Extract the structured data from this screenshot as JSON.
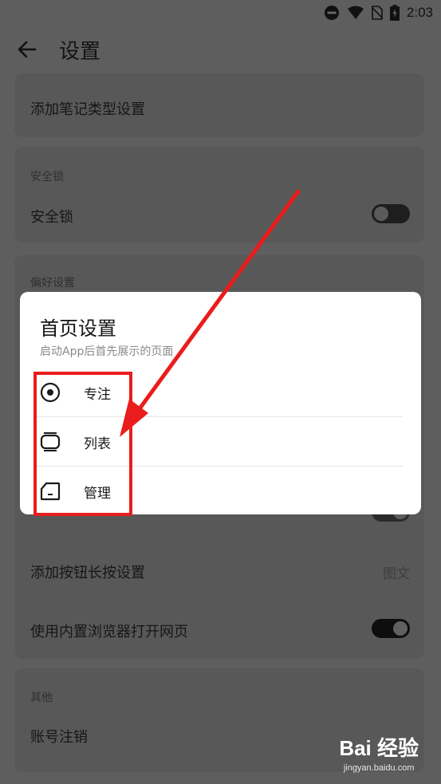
{
  "status_bar": {
    "time": "2:03"
  },
  "app_bar": {
    "title": "设置"
  },
  "settings": {
    "note_type": {
      "label": "添加笔记类型设置"
    },
    "security": {
      "header": "安全锁",
      "lock_label": "安全锁",
      "lock_enabled": false
    },
    "preferences": {
      "header": "偏好设置",
      "add_button_long_press": {
        "label": "添加按钮长按设置",
        "value": "图文"
      },
      "builtin_browser": {
        "label": "使用内置浏览器打开网页",
        "enabled": true
      }
    },
    "other": {
      "header": "其他",
      "account_cancel": {
        "label": "账号注销"
      }
    }
  },
  "dialog": {
    "title": "首页设置",
    "subtitle": "启动App后首先展示的页面",
    "options": [
      {
        "label": "专注",
        "icon": "target-icon"
      },
      {
        "label": "列表",
        "icon": "list-card-icon"
      },
      {
        "label": "管理",
        "icon": "folder-icon"
      }
    ]
  },
  "watermark": {
    "brand": "Bai 经验",
    "url": "jingyan.baidu.com"
  },
  "colors": {
    "annotation_red": "#ea1c1c",
    "dim_background": "#5e5e5e"
  }
}
